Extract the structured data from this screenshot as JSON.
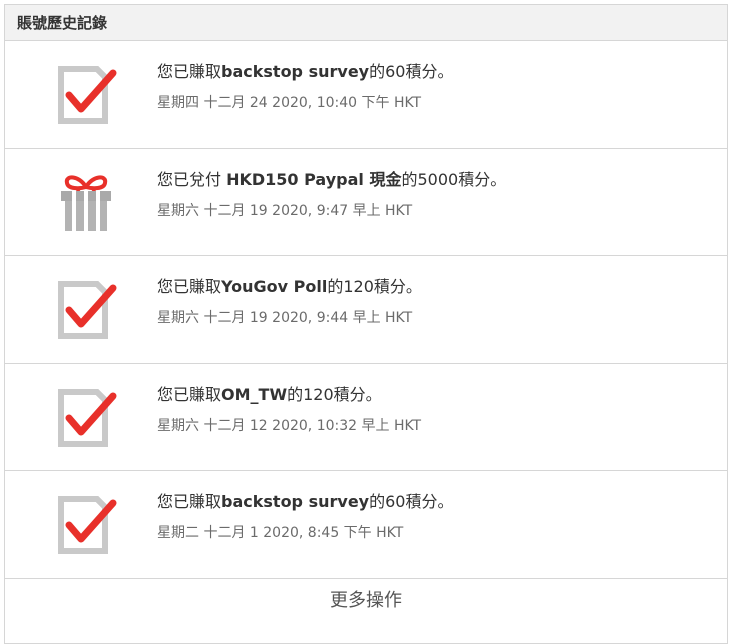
{
  "header": {
    "title": "賬號歷史記錄"
  },
  "entries": [
    {
      "icon": "checklist-icon",
      "prefix": "您已賺取",
      "bold": "backstop survey",
      "suffix": "的60積分。",
      "date": "星期四 十二月 24 2020, 10:40 下午 HKT"
    },
    {
      "icon": "gift-icon",
      "prefix": "您已兌付 ",
      "bold": "HKD150 Paypal 現金",
      "suffix": "的5000積分。",
      "date": "星期六 十二月 19 2020, 9:47 早上 HKT"
    },
    {
      "icon": "checklist-icon",
      "prefix": "您已賺取",
      "bold": "YouGov Poll",
      "suffix": "的120積分。",
      "date": "星期六 十二月 19 2020, 9:44 早上 HKT"
    },
    {
      "icon": "checklist-icon",
      "prefix": "您已賺取",
      "bold": "OM_TW",
      "suffix": "的120積分。",
      "date": "星期六 十二月 12 2020, 10:32 早上 HKT"
    },
    {
      "icon": "checklist-icon",
      "prefix": "您已賺取",
      "bold": "backstop survey",
      "suffix": "的60積分。",
      "date": "星期二 十二月 1 2020, 8:45 下午 HKT"
    }
  ],
  "footer": {
    "more_label": "更多操作"
  },
  "colors": {
    "accent_red": "#e8302a",
    "icon_gray": "#c9c9c9",
    "border": "#d6d6d6",
    "header_bg": "#f2f2f2"
  }
}
